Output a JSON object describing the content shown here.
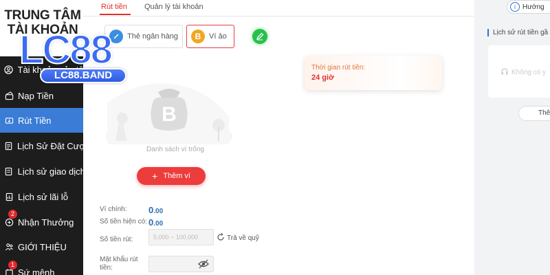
{
  "sidebar": {
    "title_line1": "TRUNG TÂM",
    "title_line2": "TÀI KHOẢN",
    "items": [
      {
        "label": "Tài khoản của tôi",
        "icon": "user-icon"
      },
      {
        "label": "Nạp Tiền",
        "icon": "wallet-icon"
      },
      {
        "label": "Rút Tiền",
        "icon": "withdraw-icon"
      },
      {
        "label": "Lịch Sử Đặt Cược",
        "icon": "document-icon"
      },
      {
        "label": "Lịch sử giao dịch",
        "icon": "receipt-icon"
      },
      {
        "label": "Lịch sử lãi lỗ",
        "icon": "chart-icon"
      },
      {
        "label": "Nhận Thưởng",
        "icon": "gift-icon",
        "badge": "2"
      },
      {
        "label": "GIỚI THIỆU",
        "icon": "share-icon"
      },
      {
        "label": "Sứ mệnh",
        "icon": "mission-icon",
        "badge": "1"
      }
    ]
  },
  "logo": {
    "main": "LC88",
    "badge": "LC88.BAND"
  },
  "tabs": [
    {
      "label": "Rút tiền"
    },
    {
      "label": "Quản lý tài khoản"
    }
  ],
  "methods": [
    {
      "label": "Thẻ ngân hàng",
      "icon": "bank-card-icon"
    },
    {
      "label": "Ví ảo",
      "icon": "bitcoin-icon"
    }
  ],
  "empty_state": {
    "text": "Danh sách ví trống"
  },
  "add_wallet": {
    "label": "Thêm ví"
  },
  "info": {
    "label": "Thời gian rút tiền:",
    "value": "24 giờ"
  },
  "form": {
    "wallet_label": "Ví chính:",
    "wallet_value": "0",
    "wallet_decimals": ".00",
    "current_label": "Số tiền hiện có:",
    "current_value": "0",
    "current_decimals": ".00",
    "amount_label": "Số tiền rút:",
    "amount_placeholder": "5,000 ~ 100,000",
    "return_label": "Trả về quỹ",
    "password_label": "Mật khẩu rút tiền:"
  },
  "right_panel": {
    "guide_label": "Hướng",
    "history_title": "Lịch sử rút tiền gầ",
    "no_data": "Không có y",
    "more_label": "Thê"
  },
  "colors": {
    "accent_red": "#ec3c3c",
    "active_blue": "#3a7cd6",
    "sidebar_bg": "#1d1d1d",
    "value_blue": "#2a6cb0"
  }
}
